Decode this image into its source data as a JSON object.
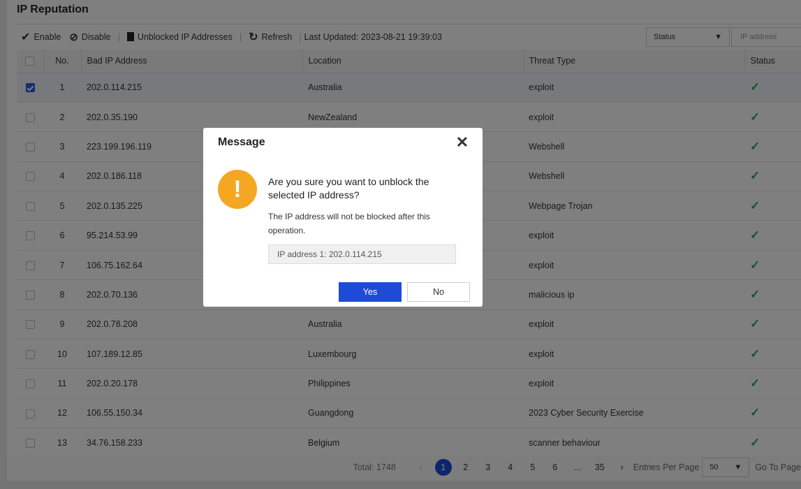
{
  "title": "IP Reputation",
  "toolbar": {
    "enable": "Enable",
    "disable": "Disable",
    "unblocked": "Unblocked IP Addresses",
    "refresh": "Refresh",
    "last_updated": "Last Updated: 2023-08-21 19:39:03",
    "status_filter": "Status",
    "ip_placeholder": "IP address"
  },
  "columns": {
    "no": "No.",
    "ip": "Bad IP Address",
    "location": "Location",
    "threat": "Threat Type",
    "status": "Status"
  },
  "rows": [
    {
      "no": "1",
      "ip": "202.0.114.215",
      "location": "Australia",
      "threat": "exploit",
      "checked": true
    },
    {
      "no": "2",
      "ip": "202.0.35.190",
      "location": "NewZealand",
      "threat": "exploit"
    },
    {
      "no": "3",
      "ip": "223.199.196.119",
      "location": "",
      "threat": "Webshell"
    },
    {
      "no": "4",
      "ip": "202.0.186.118",
      "location": "",
      "threat": "Webshell"
    },
    {
      "no": "5",
      "ip": "202.0.135.225",
      "location": "",
      "threat": "Webpage Trojan"
    },
    {
      "no": "6",
      "ip": "95.214.53.99",
      "location": "",
      "threat": "exploit"
    },
    {
      "no": "7",
      "ip": "106.75.162.64",
      "location": "",
      "threat": "exploit"
    },
    {
      "no": "8",
      "ip": "202.0.70.136",
      "location": "",
      "threat": "malicious ip"
    },
    {
      "no": "9",
      "ip": "202.0.78.208",
      "location": "Australia",
      "threat": "exploit"
    },
    {
      "no": "10",
      "ip": "107.189.12.85",
      "location": "Luxembourg",
      "threat": "exploit"
    },
    {
      "no": "11",
      "ip": "202.0.20.178",
      "location": "Philippines",
      "threat": "exploit"
    },
    {
      "no": "12",
      "ip": "106.55.150.34",
      "location": "Guangdong",
      "threat": "2023 Cyber Security Exercise"
    },
    {
      "no": "13",
      "ip": "34.76.158.233",
      "location": "Belgium",
      "threat": "scanner behaviour"
    }
  ],
  "pager": {
    "total": "Total: 1748",
    "pages": [
      "1",
      "2",
      "3",
      "4",
      "5",
      "6",
      "...",
      "35"
    ],
    "per_page_label": "Entries Per Page",
    "per_page": "50",
    "goto": "Go To Page"
  },
  "modal": {
    "title": "Message",
    "question": "Are you sure you want to unblock the selected IP address?",
    "detail": "The IP address will not be blocked after this operation.",
    "ip_list": "IP address 1: 202.0.114.215",
    "yes": "Yes",
    "no": "No"
  }
}
